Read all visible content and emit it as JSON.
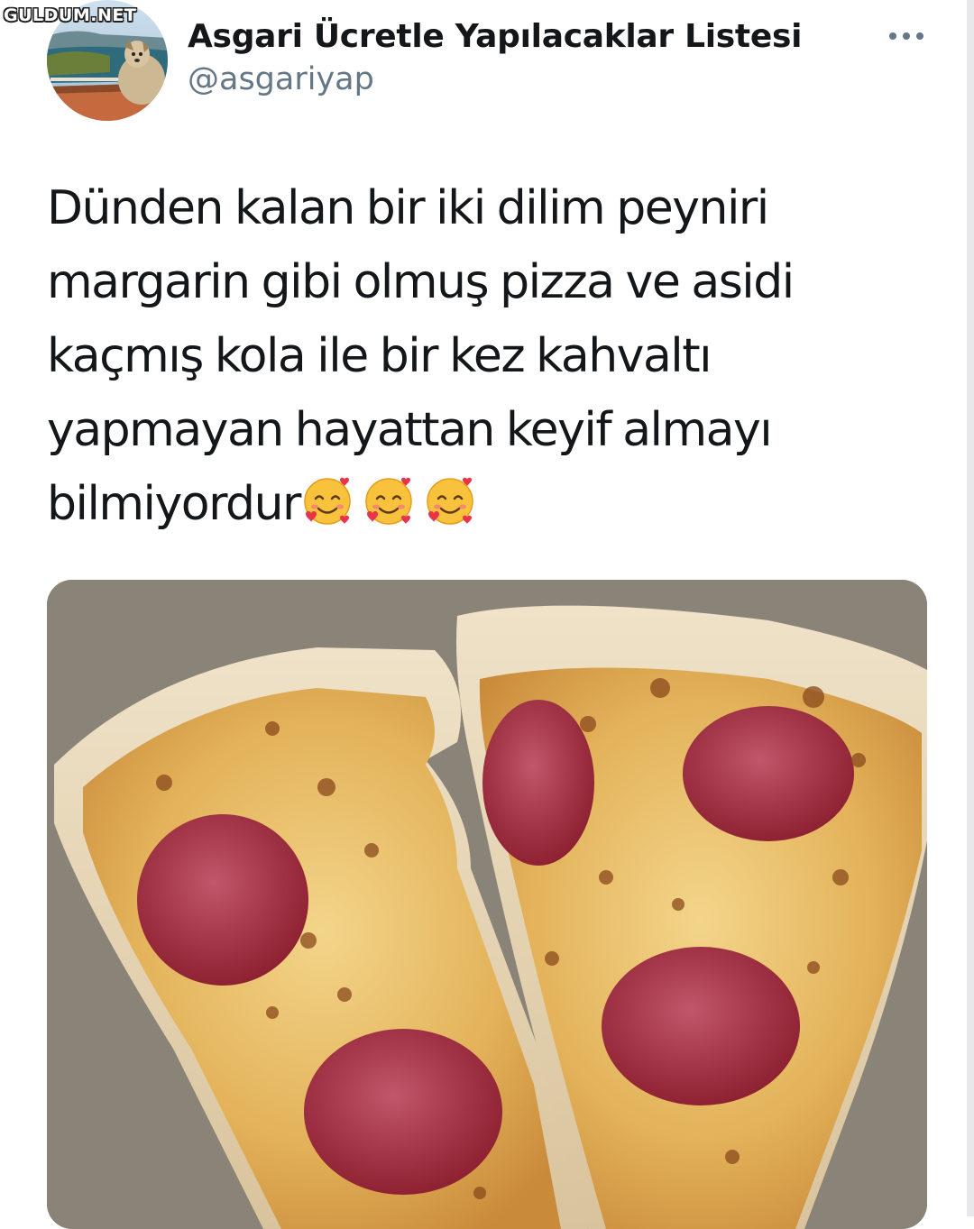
{
  "watermark": "GULDUM.NET",
  "tweet": {
    "display_name": "Asgari Ücretle Yapılacaklar Listesi",
    "handle": "@asgariyap",
    "text_lines": [
      "Dünden kalan bir iki dilim peyniri",
      "margarin gibi olmuş pizza ve asidi",
      "kaçmış kola ile bir kez kahvaltı",
      "yapmayan hayattan keyif almayı",
      "bilmiyordur"
    ],
    "emoji": [
      "smiling-face-with-hearts",
      "smiling-face-with-hearts",
      "smiling-face-with-hearts"
    ]
  },
  "icons": {
    "more": "more-horizontal-icon"
  },
  "colors": {
    "text_primary": "#14171a",
    "text_secondary": "#657786"
  }
}
